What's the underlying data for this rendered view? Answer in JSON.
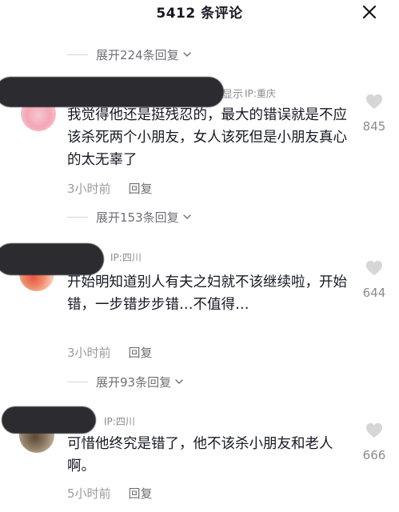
{
  "header": {
    "count": "5412",
    "title_suffix": "条评论"
  },
  "expanders": [
    {
      "label": "展开224条回复"
    },
    {
      "label": "展开153条回复"
    },
    {
      "label": "展开93条回复"
    }
  ],
  "comments": [
    {
      "name_tail": "显示",
      "ip": "IP:重庆",
      "text": "我觉得他还是挺残忍的，最大的错误就是不应该杀死两个小朋友，女人该死但是小朋友真心的太无辜了",
      "time": "3小时前",
      "reply": "回复",
      "likes": "845"
    },
    {
      "ip": "IP:四川",
      "text": "开始明知道别人有夫之妇就不该继续啦，开始错，一步错步步错…不值得…",
      "time": "3小时前",
      "reply": "回复",
      "likes": "644"
    },
    {
      "ip": "IP:四川",
      "text": "可惜他终究是错了，他不该杀小朋友和老人啊。",
      "time": "5小时前",
      "reply": "回复",
      "likes": "666"
    }
  ],
  "colors": {
    "text": "#161823",
    "secondary": "#8a8b91",
    "like_icon": "#d6d6d8"
  },
  "icons": [
    "close-icon",
    "chevron-down-icon",
    "heart-icon"
  ]
}
